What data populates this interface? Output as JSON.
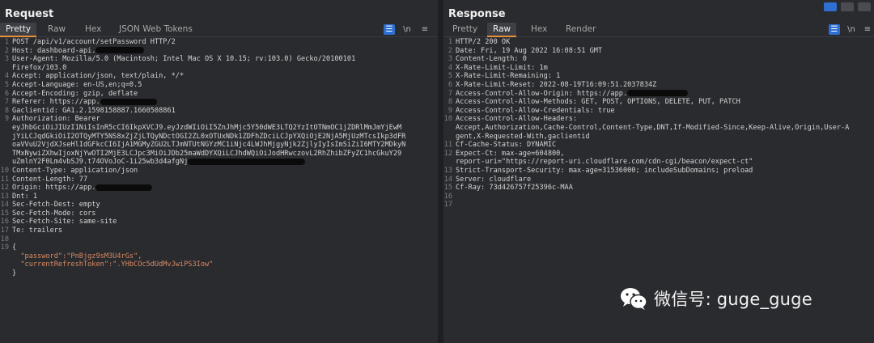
{
  "request": {
    "title": "Request",
    "tabs": [
      "Pretty",
      "Raw",
      "Hex",
      "JSON Web Tokens"
    ],
    "active_tab": "Pretty",
    "tool_icons": [
      "wrap-icon",
      "newline-icon",
      "menu-icon"
    ],
    "tool_glyphs": [
      "☰",
      "\\n",
      "≡"
    ],
    "lines": [
      {
        "n": "1",
        "t": "POST /api/v1/account/setPassword HTTP/2"
      },
      {
        "n": "2",
        "t": "Host: dashboard-api.",
        "redact": 60
      },
      {
        "n": "3",
        "t": "User-Agent: Mozilla/5.0 (Macintosh; Intel Mac OS X 10.15; rv:103.0) Gecko/20100101"
      },
      {
        "n": "",
        "t": "Firefox/103.0"
      },
      {
        "n": "4",
        "t": "Accept: application/json, text/plain, */*"
      },
      {
        "n": "5",
        "t": "Accept-Language: en-US,en;q=0.5"
      },
      {
        "n": "6",
        "t": "Accept-Encoding: gzip, deflate"
      },
      {
        "n": "7",
        "t": "Referer: https://app.",
        "redact": 70
      },
      {
        "n": "8",
        "t": "Gaclientid: GA1.2.1598158887.1660508861"
      },
      {
        "n": "9",
        "t": "Authorization: Bearer"
      },
      {
        "n": "",
        "t": "eyJhbGciOiJIUzI1NiIsInR5cCI6IkpXVCJ9.eyJzdWIiOiI5ZnJhMjc5Y50dWE3LTQ2YzItOTNmOC1jZDRlMmJmYjEwM"
      },
      {
        "n": "",
        "t": "jYiLCJqdGkiOiI2OTQyMTY5NS8xZjZjLTQyNDctOGI2ZL0xOTUxNDk1ZDFhZDciLCJpYXQiOjE2NjA5MjUzMTcsIkp3dFR"
      },
      {
        "n": "",
        "t": "oaVVuU2VjdXJseHlIdGFkcCI6IjA1MGMyZGU2LTJmNTUtNGYzMC1iNjc4LWJhMjgyNjk2ZjlyIyIsImSiZiI6MTY2MDkyN"
      },
      {
        "n": "",
        "t": "TMxNywiZXhwIjoxNjYwOTI2MjE3LCJpc3MiOiJDb25maWdDYXQiLCJhdWQiOiJodHRwczovL2RhZhibZFyZC1hcGkuY29"
      },
      {
        "n": "",
        "t": "uZmlnY2F0Lm4vbSJ9.t74OVoJoC-1i25wb3d4afgNj",
        "redact": 145
      },
      {
        "n": "10",
        "t": "Content-Type: application/json"
      },
      {
        "n": "11",
        "t": "Content-Length: 77"
      },
      {
        "n": "12",
        "t": "Origin: https://app.",
        "redact": 70
      },
      {
        "n": "13",
        "t": "Dnt: 1"
      },
      {
        "n": "14",
        "t": "Sec-Fetch-Dest: empty"
      },
      {
        "n": "15",
        "t": "Sec-Fetch-Mode: cors"
      },
      {
        "n": "16",
        "t": "Sec-Fetch-Site: same-site"
      },
      {
        "n": "17",
        "t": "Te: trailers"
      },
      {
        "n": "18",
        "t": ""
      },
      {
        "n": "19",
        "t": "{"
      },
      {
        "n": "",
        "t": "  \"password\":\"PnBjgz9sM3U4rGs\",",
        "string": true
      },
      {
        "n": "",
        "t": "  \"currentRefreshToken\":\".YHbCOc5dUdMvJwiPS3Iow\"",
        "string": true
      },
      {
        "n": "",
        "t": "}"
      }
    ]
  },
  "response": {
    "title": "Response",
    "tabs": [
      "Pretty",
      "Raw",
      "Hex",
      "Render"
    ],
    "active_tab": "Raw",
    "tool_icons": [
      "wrap-icon",
      "newline-icon",
      "menu-icon"
    ],
    "tool_glyphs": [
      "☰",
      "\\n",
      "≡"
    ],
    "lines": [
      {
        "n": "1",
        "t": "HTTP/2 200 OK"
      },
      {
        "n": "2",
        "t": "Date: Fri, 19 Aug 2022 16:08:51 GMT"
      },
      {
        "n": "3",
        "t": "Content-Length: 0"
      },
      {
        "n": "4",
        "t": "X-Rate-Limit-Limit: 1m"
      },
      {
        "n": "5",
        "t": "X-Rate-Limit-Remaining: 1"
      },
      {
        "n": "6",
        "t": "X-Rate-Limit-Reset: 2022-08-19T16:09:51.2037834Z"
      },
      {
        "n": "7",
        "t": "Access-Control-Allow-Origin: https://app.",
        "redact": 75
      },
      {
        "n": "8",
        "t": "Access-Control-Allow-Methods: GET, POST, OPTIONS, DELETE, PUT, PATCH"
      },
      {
        "n": "9",
        "t": "Access-Control-Allow-Credentials: true"
      },
      {
        "n": "10",
        "t": "Access-Control-Allow-Headers:"
      },
      {
        "n": "",
        "t": "Accept,Authorization,Cache-Control,Content-Type,DNT,If-Modified-Since,Keep-Alive,Origin,User-A"
      },
      {
        "n": "",
        "t": "gent,X-Requested-With,gaclientid"
      },
      {
        "n": "11",
        "t": "Cf-Cache-Status: DYNAMIC"
      },
      {
        "n": "12",
        "t": "Expect-Ct: max-age=604800,"
      },
      {
        "n": "",
        "t": "report-uri=\"https://report-uri.cloudflare.com/cdn-cgi/beacon/expect-ct\""
      },
      {
        "n": "13",
        "t": "Strict-Transport-Security: max-age=31536000; includeSubDomains; preload"
      },
      {
        "n": "14",
        "t": "Server: cloudflare"
      },
      {
        "n": "15",
        "t": "Cf-Ray: 73d426757f25396c-MAA"
      },
      {
        "n": "16",
        "t": ""
      },
      {
        "n": "17",
        "t": ""
      }
    ]
  },
  "view_toggles": [
    "layout-split-icon",
    "layout-horizontal-icon",
    "layout-vertical-icon"
  ],
  "watermark": {
    "text": "微信号: guge_guge",
    "icon": "wechat-icon"
  },
  "colors": {
    "accent_tab": "#e8913a",
    "tool_blue": "#2f6fd1",
    "background": "#2a2b2f",
    "string": "#d98a62"
  }
}
